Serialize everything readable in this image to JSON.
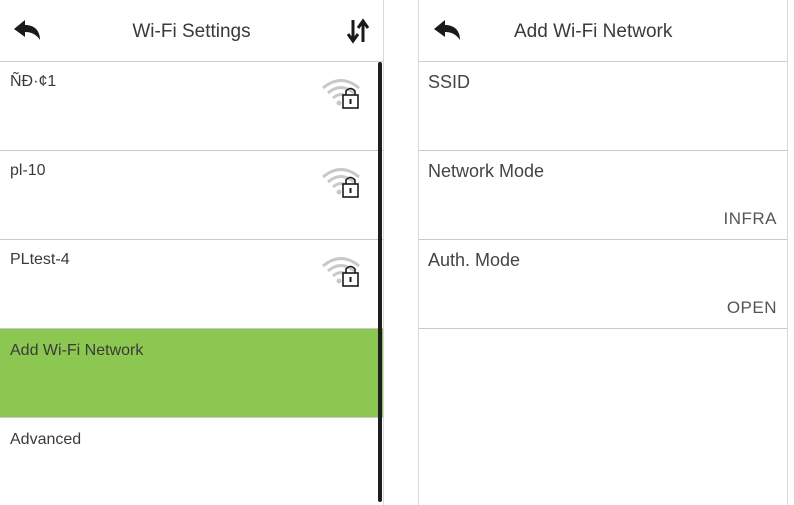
{
  "left_screen": {
    "title": "Wi-Fi Settings",
    "back_icon": "back-arrow-icon",
    "sort_icon": "sort-arrows-icon",
    "networks": [
      {
        "ssid": "ÑÐ·¢1",
        "icon": "wifi-locked-icon"
      },
      {
        "ssid": "pl-10",
        "icon": "wifi-locked-icon"
      },
      {
        "ssid": "PLtest-4",
        "icon": "wifi-locked-icon"
      }
    ],
    "menu": [
      {
        "label": "Add Wi-Fi Network",
        "selected": true
      },
      {
        "label": "Advanced",
        "selected": false
      }
    ]
  },
  "right_screen": {
    "title": "Add Wi-Fi Network",
    "back_icon": "back-arrow-icon",
    "fields": [
      {
        "label": "SSID",
        "value": ""
      },
      {
        "label": "Network Mode",
        "value": "INFRA"
      },
      {
        "label": "Auth. Mode",
        "value": "OPEN"
      }
    ]
  },
  "colors": {
    "selected_row": "#8cc751",
    "divider": "#c9c9c9",
    "icon_gray": "#c8c8c8"
  }
}
